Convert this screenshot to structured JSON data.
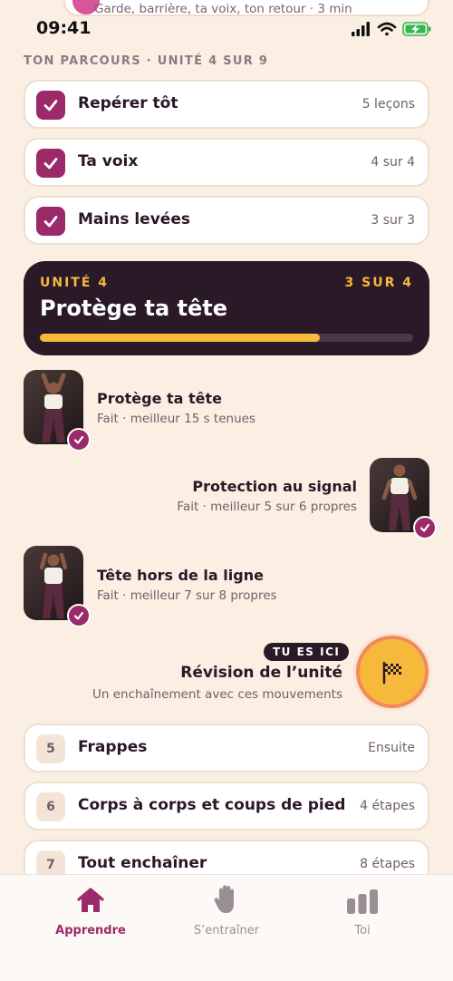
{
  "top_card": {
    "subtitle": "Garde, barrière, ta voix, ton retour · 3 min"
  },
  "status_bar": {
    "time": "09:41"
  },
  "section_title": "TON PARCOURS · UNITÉ 4 SUR 9",
  "completed_units": [
    {
      "label": "Repérer tôt",
      "meta": "5 leçons"
    },
    {
      "label": "Ta voix",
      "meta": "4 sur 4"
    },
    {
      "label": "Mains levées",
      "meta": "3 sur 3"
    }
  ],
  "current_unit": {
    "tag": "UNITÉ 4",
    "count": "3 SUR 4",
    "title": "Protège ta tête",
    "progress": 0.75
  },
  "lessons": [
    {
      "title": "Protège ta tête",
      "subtitle": "Fait · meilleur 15 s tenues"
    },
    {
      "title": "Protection au signal",
      "subtitle": "Fait · meilleur 5 sur 6 propres"
    },
    {
      "title": "Tête hors de la ligne",
      "subtitle": "Fait · meilleur 7 sur 8 propres"
    }
  ],
  "review": {
    "badge": "TU ES ICI",
    "title": "Révision de l’unité",
    "subtitle": "Un enchaînement avec ces mouvements",
    "icon": "checkered-flag-icon"
  },
  "upcoming_units": [
    {
      "number": "5",
      "label": "Frappes",
      "meta": "Ensuite"
    },
    {
      "number": "6",
      "label": "Corps à corps et coups de pied",
      "meta": "4 étapes"
    },
    {
      "number": "7",
      "label": "Tout enchaîner",
      "meta": "8 étapes"
    }
  ],
  "tabs": [
    {
      "label": "Apprendre",
      "icon": "home-icon",
      "active": true
    },
    {
      "label": "S’entraîner",
      "icon": "hand-icon",
      "active": false
    },
    {
      "label": "Toi",
      "icon": "stats-icon",
      "active": false
    }
  ],
  "colors": {
    "accent": "#9b2a6a",
    "highlight": "#f7b93c",
    "background": "#fbeee3",
    "dark": "#2a1a27"
  }
}
